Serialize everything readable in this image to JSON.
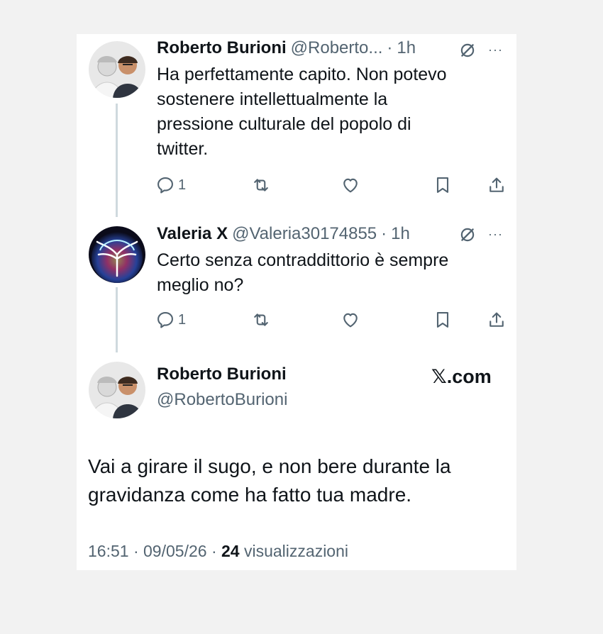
{
  "tweet1": {
    "name": "Roberto Burioni",
    "handle": "@Roberto...",
    "time": "1h",
    "text_lines": [
      "Ha perfettamente capito. Non potevo",
      "sostenere intellettualmente la",
      "pressione culturale del popolo di",
      "twitter."
    ],
    "reply_count": "1"
  },
  "tweet2": {
    "name": "Valeria X",
    "handle": "@Valeria30174855",
    "time": "1h",
    "text_lines": [
      "Certo senza contraddittorio è sempre",
      "meglio no?"
    ],
    "reply_count": "1"
  },
  "main_tweet": {
    "name": "Roberto Burioni",
    "handle": "@RobertoBurioni",
    "brand": "𝕏.com",
    "text_lines": [
      "Vai a girare il sugo, e non bere durante la",
      "gravidanza come ha fatto tua madre."
    ],
    "time": "16:51",
    "date": "09/05/26",
    "views_count": "24",
    "views_label": "visualizzazioni"
  },
  "separator": "·",
  "more_label": "···",
  "icons": [
    "reply-icon",
    "retweet-icon",
    "like-icon",
    "bookmark-icon",
    "share-icon",
    "grok-icon"
  ],
  "colors": {
    "text": "#0f1419",
    "secondary": "#536471",
    "thread": "#cfd9de",
    "background": "#ffffff"
  }
}
